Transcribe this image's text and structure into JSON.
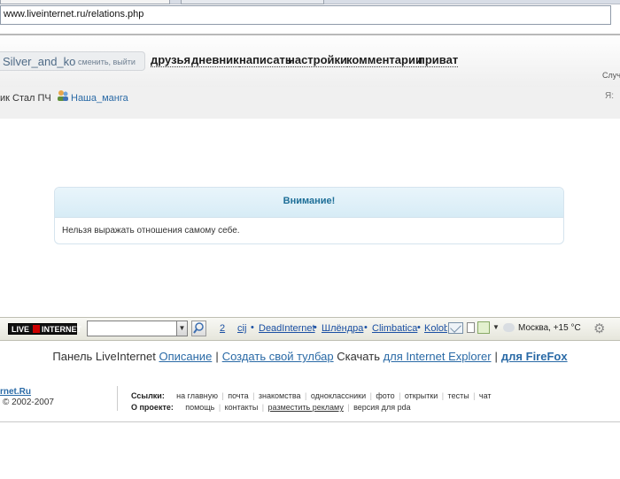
{
  "browser": {
    "address": "www.liveinternet.ru/relations.php"
  },
  "header": {
    "username": "Silver_and_ko",
    "change_link": "сменить, выйти",
    "nav": [
      "друзья",
      "дневник",
      "написать",
      "настройки",
      "комментарии",
      "приват"
    ],
    "right_fragment": "Случ"
  },
  "quickbar": {
    "text_before": "ик Стал ПЧ",
    "link": "Наша_манга",
    "right_fragment": "Я:"
  },
  "alert": {
    "title": "Внимание!",
    "message": "Нельзя выражать отношения самому себе."
  },
  "toolbar": {
    "logo_left": "LIVE",
    "logo_right": "INTERNET",
    "search_value": "",
    "count": "2",
    "links": [
      "cij",
      "DeadInternet",
      "Шлёндра",
      "Climbatica",
      "Kolob"
    ],
    "weather": "Москва, +15 °C"
  },
  "panel": {
    "prefix": "Панель LiveInternet",
    "description": "Описание",
    "create": "Создать свой тулбар",
    "download": "Скачать",
    "ie": "для Internet Explorer",
    "firefox": "для FireFox"
  },
  "footer": {
    "brand": "rnet.Ru",
    "copyright": "© 2002-2007",
    "links_label": "Ссылки:",
    "links": [
      "на главную",
      "почта",
      "знакомства",
      "одноклассники",
      "фото",
      "открытки",
      "тесты",
      "чат"
    ],
    "about_label": "О проекте:",
    "about": [
      "помощь",
      "контакты",
      "разместить рекламу",
      "версия для pda"
    ]
  },
  "colors": {
    "link": "#2a6aa6",
    "alert_title": "#1e6f98",
    "alert_header": "#d7ecf6"
  }
}
